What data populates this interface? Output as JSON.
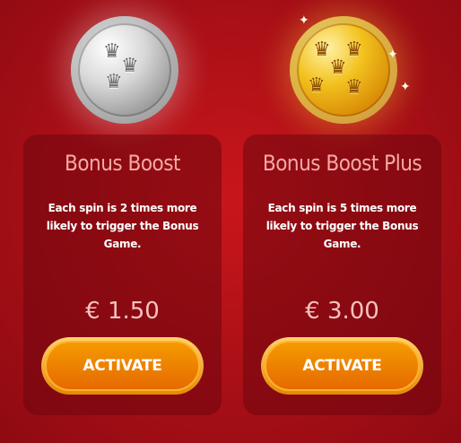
{
  "offers": [
    {
      "title": "Bonus Boost",
      "description": "Each spin is 2 times more likely to trigger the Bonus Game.",
      "price": "€ 1.50",
      "button_label": "ACTIVATE",
      "coin": "silver-crown-coin-icon"
    },
    {
      "title": "Bonus Boost Plus",
      "description": "Each spin is 5 times more likely to trigger the Bonus Game.",
      "price": "€ 3.00",
      "button_label": "ACTIVATE",
      "coin": "gold-crown-coin-icon"
    }
  ],
  "colors": {
    "background": "#b5121a",
    "card": "#6e060e",
    "title": "#f5a9a6",
    "button": "#f08a00"
  }
}
